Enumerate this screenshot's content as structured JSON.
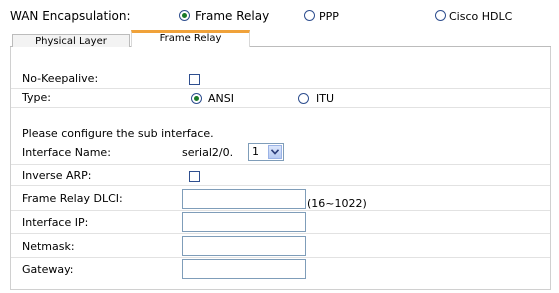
{
  "wan": {
    "label": "WAN Encapsulation:",
    "options": [
      {
        "label": "Frame Relay",
        "checked": true
      },
      {
        "label": "PPP",
        "checked": false
      },
      {
        "label": "Cisco HDLC",
        "checked": false
      }
    ]
  },
  "tabs": [
    {
      "label": "Physical Layer",
      "active": false
    },
    {
      "label": "Frame Relay",
      "active": true
    }
  ],
  "form": {
    "no_keepalive_label": "No-Keepalive:",
    "type_label": "Type:",
    "type_options": [
      {
        "label": "ANSI",
        "checked": true
      },
      {
        "label": "ITU",
        "checked": false
      }
    ],
    "sub_heading": "Please configure the sub interface.",
    "interface_name_label": "Interface Name:",
    "interface_prefix": "serial2/0.",
    "interface_select_value": "1",
    "inverse_arp_label": "Inverse ARP:",
    "dlci_label": "Frame Relay DLCI:",
    "dlci_value": "",
    "dlci_hint": "(16~1022)",
    "ip_label": "Interface IP:",
    "ip_value": "",
    "netmask_label": "Netmask:",
    "netmask_value": "",
    "gateway_label": "Gateway:",
    "gateway_value": ""
  }
}
